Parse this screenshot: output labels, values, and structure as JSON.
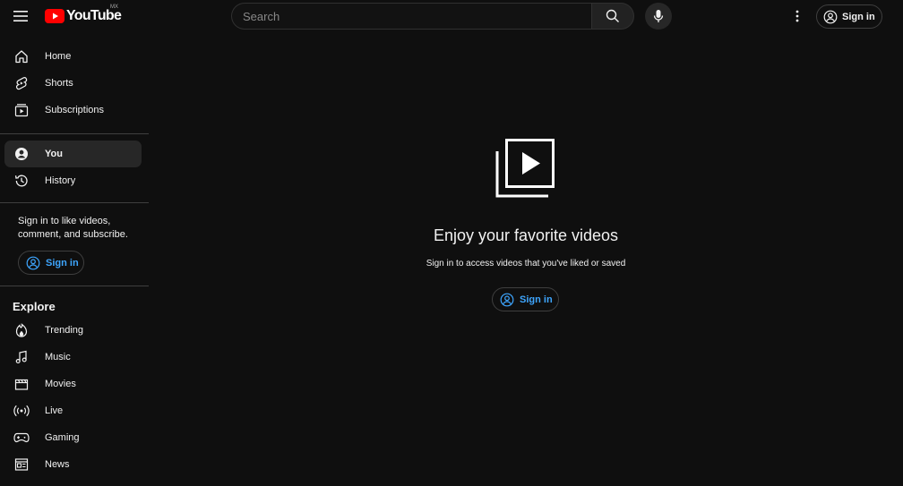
{
  "header": {
    "logo_text": "YouTube",
    "country_code": "MX",
    "search_placeholder": "Search",
    "sign_in_label": "Sign in"
  },
  "sidebar": {
    "main_items": [
      {
        "label": "Home",
        "icon": "home-icon"
      },
      {
        "label": "Shorts",
        "icon": "shorts-icon"
      },
      {
        "label": "Subscriptions",
        "icon": "subscriptions-icon"
      }
    ],
    "you_items": [
      {
        "label": "You",
        "icon": "account-icon",
        "active": true
      },
      {
        "label": "History",
        "icon": "history-icon"
      }
    ],
    "sign_prompt": "Sign in to like videos, comment, and subscribe.",
    "sign_in_label": "Sign in",
    "explore_title": "Explore",
    "explore_items": [
      {
        "label": "Trending",
        "icon": "trending-icon"
      },
      {
        "label": "Music",
        "icon": "music-icon"
      },
      {
        "label": "Movies",
        "icon": "movies-icon"
      },
      {
        "label": "Live",
        "icon": "live-icon"
      },
      {
        "label": "Gaming",
        "icon": "gaming-icon"
      },
      {
        "label": "News",
        "icon": "news-icon"
      }
    ]
  },
  "main": {
    "title": "Enjoy your favorite videos",
    "subtitle": "Sign in to access videos that you've liked or saved",
    "sign_in_label": "Sign in"
  },
  "colors": {
    "background": "#0f0f0f",
    "accent_blue": "#3ea6ff",
    "brand_red": "#ff0000",
    "active_item": "#272727"
  }
}
